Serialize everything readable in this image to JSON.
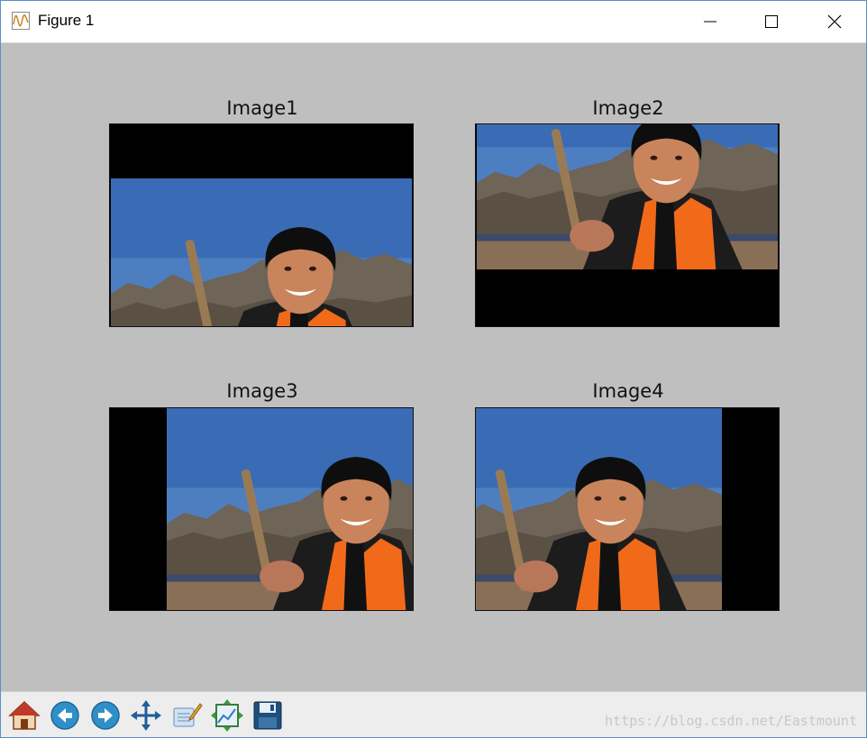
{
  "window": {
    "title": "Figure 1",
    "icon": "waveform-figure-icon",
    "controls": [
      "minimize-icon",
      "maximize-icon",
      "close-icon"
    ]
  },
  "figure": {
    "subplots": [
      {
        "title": "Image1"
      },
      {
        "title": "Image2"
      },
      {
        "title": "Image3"
      },
      {
        "title": "Image4"
      }
    ]
  },
  "toolbar": {
    "tools": [
      "home-icon",
      "back-icon",
      "forward-icon",
      "pan-icon",
      "configure-subplots-icon",
      "zoom-to-rect-icon",
      "save-icon"
    ]
  },
  "watermark": "https://blog.csdn.net/Eastmount"
}
